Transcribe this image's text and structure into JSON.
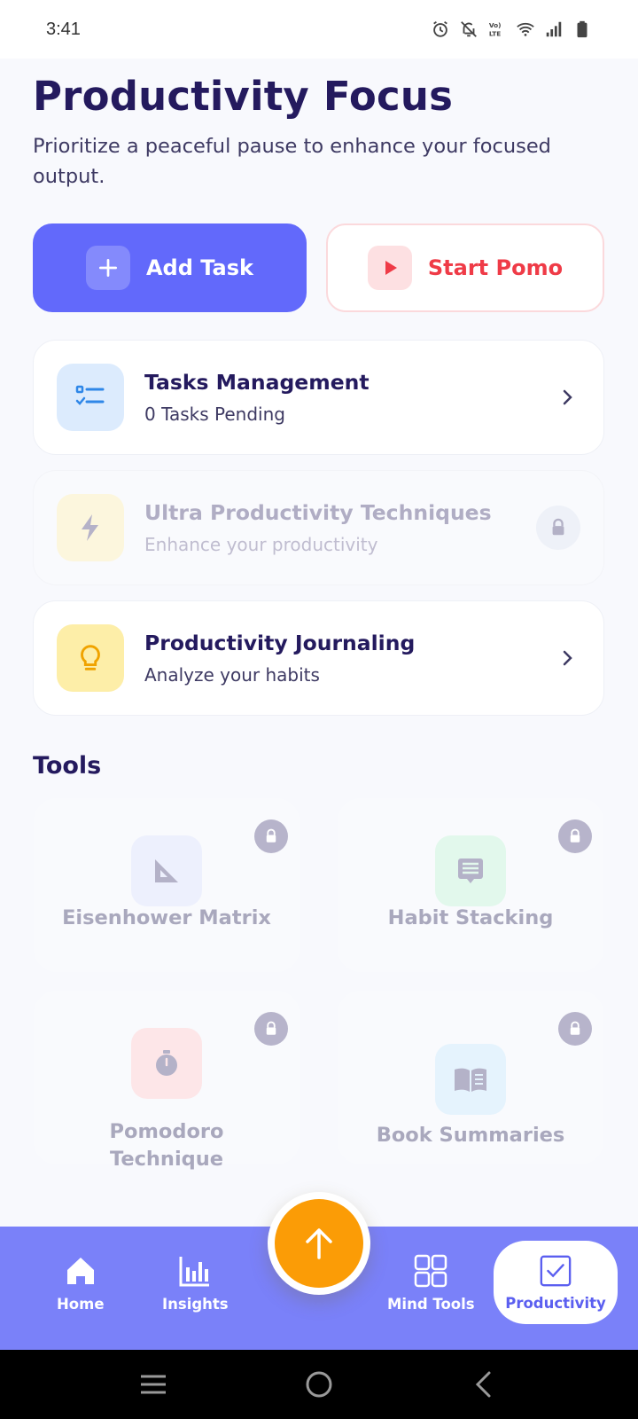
{
  "status_bar": {
    "time": "3:41",
    "icons": [
      "alarm-icon",
      "bell-off-icon",
      "volte-icon",
      "wifi-icon",
      "signal-icon",
      "battery-icon"
    ]
  },
  "header": {
    "title": "Productivity Focus",
    "subtitle": "Prioritize a peaceful pause to enhance your focused output."
  },
  "actions": {
    "add_task": "Add Task",
    "start_pomo": "Start Pomo"
  },
  "cards": [
    {
      "title": "Tasks Management",
      "subtitle": "0 Tasks Pending",
      "locked": false,
      "icon": "checklist-icon"
    },
    {
      "title": "Ultra Productivity Techniques",
      "subtitle": "Enhance your productivity",
      "locked": true,
      "icon": "lightning-icon"
    },
    {
      "title": "Productivity Journaling",
      "subtitle": "Analyze your habits",
      "locked": false,
      "icon": "lightbulb-icon"
    }
  ],
  "tools": {
    "section_title": "Tools",
    "items": [
      {
        "label": "Eisenhower Matrix",
        "icon": "set-square-icon",
        "locked": true
      },
      {
        "label": "Habit Stacking",
        "icon": "stack-icon",
        "locked": true
      },
      {
        "label": "Pomodoro Technique",
        "icon": "stopwatch-icon",
        "locked": true
      },
      {
        "label": "Book Summaries",
        "icon": "book-icon",
        "locked": true
      }
    ]
  },
  "bottom_nav": {
    "items": [
      {
        "label": "Home",
        "icon": "home-icon"
      },
      {
        "label": "Insights",
        "icon": "bar-chart-icon"
      },
      {
        "label": "Mind Tools",
        "icon": "grid-icon"
      },
      {
        "label": "Productivity",
        "icon": "checkbox-icon",
        "active": true
      }
    ],
    "fab_icon": "arrow-up-icon"
  },
  "colors": {
    "primary": "#6269fb",
    "nav_bg": "#7a81f9",
    "accent_orange": "#fb9c06",
    "pomo_red": "#ef3b47",
    "title_dark": "#241a5e"
  }
}
